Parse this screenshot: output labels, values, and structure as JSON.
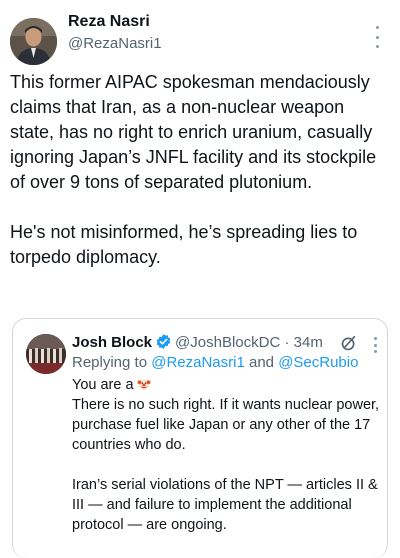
{
  "author": {
    "name": "Reza Nasri",
    "handle": "@RezaNasri1"
  },
  "tweet": {
    "paragraph1": "This former AIPAC spokesman mendaciously claims that Iran, as a non-nuclear weapon state, has no right to enrich uranium, casually ignoring Japan’s JNFL facility and its stockpile of over 9 tons of separated plutonium.",
    "paragraph2": "He's not misinformed, he’s spreading lies to torpedo diplomacy."
  },
  "quote": {
    "name": "Josh Block",
    "handle": "@JoshBlockDC",
    "separator": " · ",
    "time": "34m",
    "reply_prefix": "Replying to ",
    "reply_mention1": "@RezaNasri1",
    "reply_and": " and ",
    "reply_mention2": "@SecRubio",
    "line1": "You are a",
    "line2": "There is no such right. If it wants nuclear power, purchase fuel like Japan or any other of the 17 countries who do.",
    "line3": "Iran’s serial violations of the NPT — articles II & III — and failure to implement the additional protocol — are ongoing."
  },
  "colors": {
    "link": "#1d9bf0",
    "secondary_text": "#536471",
    "verified_badge": "#1d9bf0",
    "border": "#cfd9de"
  },
  "icons": [
    "more-icon",
    "verified-badge-icon",
    "grok-icon",
    "clown-emoji-icon"
  ]
}
